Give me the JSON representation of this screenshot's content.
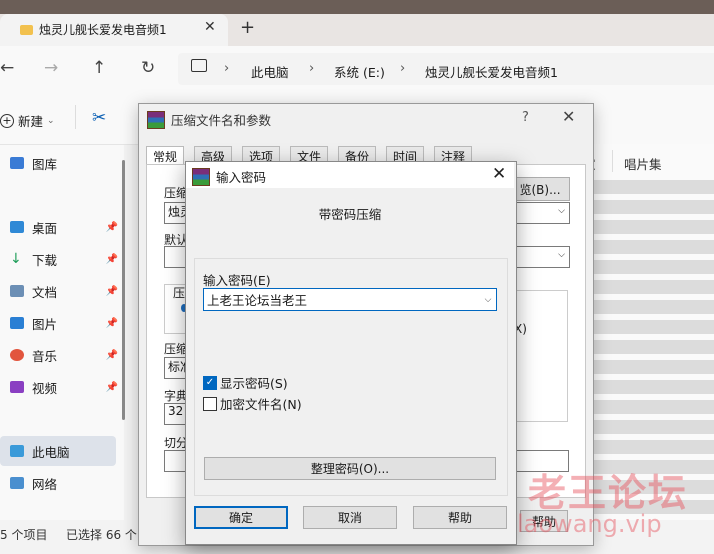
{
  "explorer": {
    "tab_title": "烛灵儿舰长爱发电音频1",
    "new_tab": "+",
    "breadcrumbs": [
      "此电脑",
      "系统 (E:)",
      "烛灵儿舰长爱发电音频1"
    ],
    "cmd_new": "新建",
    "sidebar": [
      {
        "label": "图库",
        "icon": "gallery-icon",
        "pinned": false
      },
      {
        "label": "桌面",
        "icon": "desktop-icon",
        "pinned": true
      },
      {
        "label": "下载",
        "icon": "download-icon",
        "pinned": true
      },
      {
        "label": "文档",
        "icon": "document-icon",
        "pinned": true
      },
      {
        "label": "图片",
        "icon": "pictures-icon",
        "pinned": true
      },
      {
        "label": "音乐",
        "icon": "music-icon",
        "pinned": true
      },
      {
        "label": "视频",
        "icon": "video-icon",
        "pinned": true
      },
      {
        "label": "此电脑",
        "icon": "pc-icon",
        "pinned": false
      },
      {
        "label": "网络",
        "icon": "network-icon",
        "pinned": false
      }
    ],
    "column_partial": "家",
    "column_album": "唱片集",
    "status_count": "5 个项目",
    "status_selected": "已选择 66 个"
  },
  "rar_dialog": {
    "title": "压缩文件名和参数",
    "help": "?",
    "tabs": [
      "常规",
      "高级",
      "选项",
      "文件",
      "备份",
      "时间",
      "注释"
    ],
    "frag_archive": "压缩",
    "frag_archive_value": "烛灵",
    "frag_default": "默认",
    "frag_update": "压",
    "frag_format": "压缩",
    "frag_format_value": "标准",
    "frag_dict": "字典",
    "frag_dict_value": "32",
    "frag_split": "切分",
    "browse": "览(B)...",
    "frag_x": "X)",
    "help_btn": "帮助"
  },
  "pw_dialog": {
    "title": "输入密码",
    "heading": "带密码压缩",
    "label": "输入密码(E)",
    "password_value": "上老王论坛当老王",
    "dropdown": "⌵",
    "show_password": "显示密码(S)",
    "show_password_checked": true,
    "encrypt_names": "加密文件名(N)",
    "encrypt_names_checked": false,
    "manage": "整理密码(O)...",
    "ok": "确定",
    "cancel": "取消",
    "help": "帮助"
  },
  "watermark": {
    "text": "老王论坛",
    "url": "laowang.vip"
  },
  "colors": {
    "accent": "#0067c0",
    "watermark": "#e6505a"
  }
}
